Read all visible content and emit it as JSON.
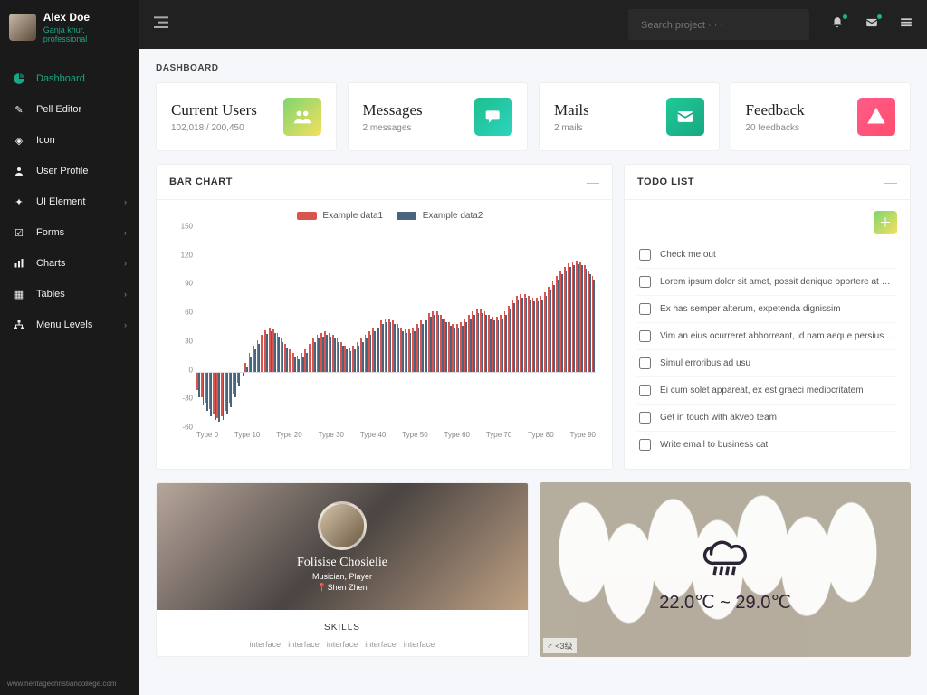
{
  "user": {
    "name": "Alex Doe",
    "role": "Ganja khur, professional"
  },
  "nav": {
    "items": [
      {
        "label": "Dashboard"
      },
      {
        "label": "Pell Editor"
      },
      {
        "label": "Icon"
      },
      {
        "label": "User Profile"
      },
      {
        "label": "UI Element"
      },
      {
        "label": "Forms"
      },
      {
        "label": "Charts"
      },
      {
        "label": "Tables"
      },
      {
        "label": "Menu Levels"
      }
    ]
  },
  "search": {
    "placeholder": "Search project · · ·"
  },
  "breadcrumb": "DASHBOARD",
  "cards": {
    "users": {
      "title": "Current Users",
      "sub": "102,018 / 200,450"
    },
    "messages": {
      "title": "Messages",
      "sub": "2 messages"
    },
    "mails": {
      "title": "Mails",
      "sub": "2 mails"
    },
    "feedback": {
      "title": "Feedback",
      "sub": "20 feedbacks"
    }
  },
  "barchart": {
    "title": "BAR CHART",
    "legend": {
      "a": "Example data1",
      "b": "Example data2"
    }
  },
  "chart_data": {
    "type": "bar",
    "title": "BAR CHART",
    "xlabel": "",
    "ylabel": "",
    "ylim": [
      -60,
      150
    ],
    "categories": [
      "Type 0",
      "Type 10",
      "Type 20",
      "Type 30",
      "Type 40",
      "Type 50",
      "Type 60",
      "Type 70",
      "Type 80",
      "Type 90"
    ],
    "x": [
      0,
      1,
      2,
      3,
      4,
      5,
      6,
      7,
      8,
      9,
      10,
      11,
      12,
      13,
      14,
      15,
      16,
      17,
      18,
      19,
      20,
      21,
      22,
      23,
      24,
      25,
      26,
      27,
      28,
      29,
      30,
      31,
      32,
      33,
      34,
      35,
      36,
      37,
      38,
      39,
      40,
      41,
      42,
      43,
      44,
      45,
      46,
      47,
      48,
      49,
      50,
      51,
      52,
      53,
      54,
      55,
      56,
      57,
      58,
      59,
      60,
      61,
      62,
      63,
      64,
      65,
      66,
      67,
      68,
      69,
      70,
      71,
      72,
      73,
      74,
      75,
      76,
      77,
      78,
      79,
      80,
      81,
      82,
      83,
      84,
      85,
      86,
      87,
      88,
      89,
      90,
      91,
      92,
      93,
      94,
      95,
      96,
      97,
      98,
      99
    ],
    "series": [
      {
        "name": "Example data1",
        "color": "#d9534f",
        "values": [
          -20,
          -28,
          -34,
          -40,
          -46,
          -50,
          -48,
          -42,
          -34,
          -24,
          -12,
          0,
          10,
          20,
          28,
          34,
          40,
          45,
          48,
          46,
          42,
          36,
          30,
          24,
          20,
          18,
          20,
          24,
          30,
          36,
          40,
          42,
          44,
          42,
          40,
          36,
          32,
          28,
          26,
          28,
          32,
          36,
          40,
          44,
          48,
          52,
          56,
          58,
          58,
          56,
          52,
          48,
          46,
          46,
          48,
          52,
          56,
          60,
          64,
          66,
          66,
          62,
          58,
          54,
          52,
          52,
          54,
          58,
          62,
          66,
          68,
          68,
          66,
          62,
          60,
          60,
          62,
          66,
          72,
          78,
          82,
          84,
          84,
          82,
          80,
          80,
          82,
          86,
          92,
          98,
          104,
          110,
          114,
          118,
          120,
          121,
          120,
          116,
          110,
          104
        ]
      },
      {
        "name": "Example data2",
        "color": "#49647d",
        "values": [
          -28,
          -36,
          -42,
          -48,
          -52,
          -54,
          -52,
          -46,
          -38,
          -28,
          -16,
          -4,
          6,
          16,
          24,
          30,
          36,
          41,
          44,
          42,
          38,
          32,
          26,
          20,
          16,
          14,
          16,
          20,
          26,
          32,
          36,
          38,
          40,
          38,
          36,
          32,
          28,
          24,
          22,
          24,
          28,
          32,
          36,
          40,
          44,
          48,
          52,
          54,
          54,
          52,
          48,
          44,
          42,
          42,
          44,
          48,
          52,
          56,
          60,
          62,
          62,
          58,
          54,
          50,
          48,
          48,
          50,
          54,
          58,
          62,
          64,
          64,
          62,
          58,
          56,
          56,
          58,
          62,
          68,
          74,
          78,
          80,
          80,
          78,
          76,
          76,
          78,
          82,
          88,
          94,
          100,
          106,
          110,
          114,
          116,
          117,
          116,
          112,
          106,
          100
        ]
      }
    ]
  },
  "todo": {
    "title": "TODO LIST",
    "items": [
      "Check me out",
      "Lorem ipsum dolor sit amet, possit denique oportere at …",
      "Ex has semper alterum, expetenda dignissim",
      "Vim an eius ocurreret abhorreant, id nam aeque persius …",
      "Simul erroribus ad usu",
      "Ei cum solet appareat, ex est graeci mediocritatem",
      "Get in touch with akveo team",
      "Write email to business cat"
    ]
  },
  "profile": {
    "name": "Folisise Chosielie",
    "title": "Musician, Player",
    "location": "Shen Zhen",
    "skills_label": "SKILLS",
    "skills": [
      "interface",
      "interface",
      "interface",
      "interface",
      "interface"
    ]
  },
  "weather": {
    "temp_low": "22.0℃",
    "sep": " ~ ",
    "temp_high": "29.0℃",
    "chip": "♂ <3级"
  },
  "watermark": "www.heritagechristiancollege.com"
}
